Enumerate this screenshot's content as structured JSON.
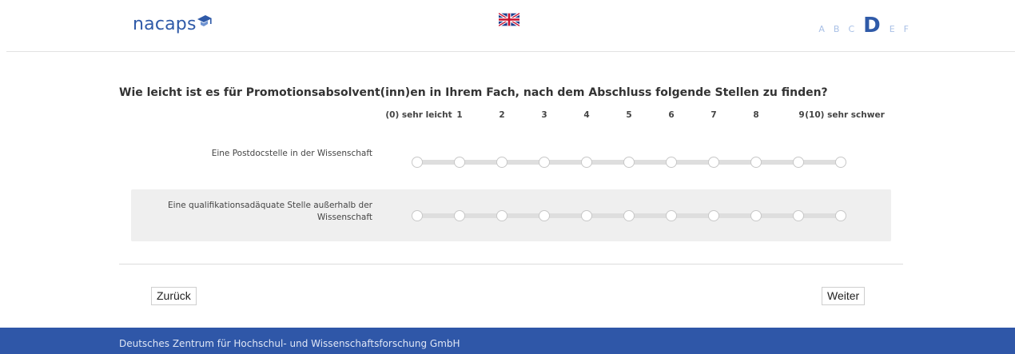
{
  "header": {
    "logo_text": "nacaps",
    "language_flag": "uk-flag-icon",
    "steps": [
      "A",
      "B",
      "C",
      "D",
      "E",
      "F"
    ],
    "active_step": "D"
  },
  "question": {
    "text": "Wie leicht ist es für Promotionsabsolvent(inn)en in Ihrem Fach, nach dem Abschluss folgende Stellen zu finden?",
    "scale": [
      "(0) sehr leicht",
      "1",
      "2",
      "3",
      "4",
      "5",
      "6",
      "7",
      "8",
      "9",
      "(10) sehr schwer"
    ],
    "items": [
      {
        "label": "Eine Postdocstelle in der Wissenschaft"
      },
      {
        "label_line1": "Eine qualifikationsadäquate Stelle außerhalb der",
        "label_line2": "Wissenschaft"
      }
    ]
  },
  "nav": {
    "back_label": "Zurück",
    "next_label": "Weiter"
  },
  "footer": {
    "text": "Deutsches Zentrum für Hochschul- und Wissenschaftsforschung GmbH"
  },
  "colors": {
    "brand_blue": "#2f5aa8",
    "step_inactive": "#a9c0e6",
    "footer_bg": "#2f57a8"
  }
}
